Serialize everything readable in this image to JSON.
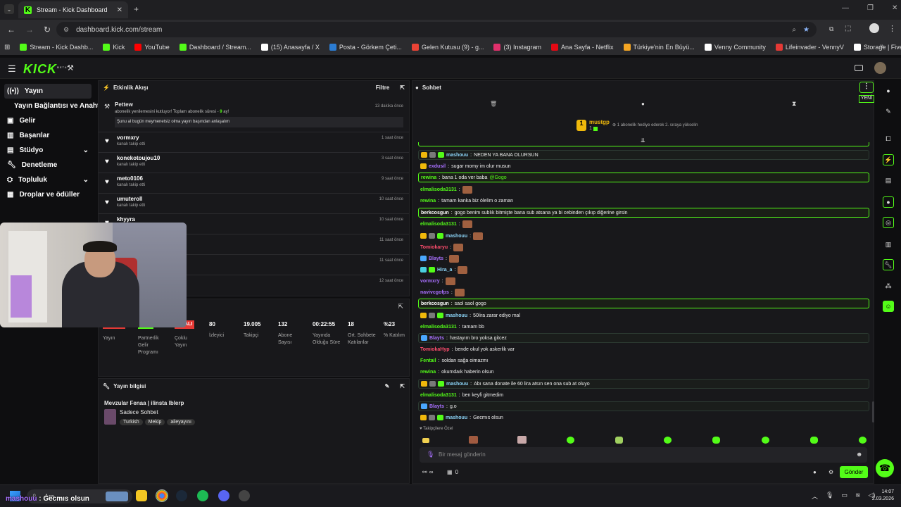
{
  "browser": {
    "tab_title": "Stream - Kick Dashboard",
    "url": "dashboard.kick.com/stream"
  },
  "bookmarks": [
    {
      "label": "Stream - Kick Dashb...",
      "color": "#53fc18"
    },
    {
      "label": "Kick",
      "color": "#53fc18"
    },
    {
      "label": "YouTube",
      "color": "#ff0000"
    },
    {
      "label": "Dashboard / Stream...",
      "color": "#53fc18"
    },
    {
      "label": "(15) Anasayfa / X",
      "color": "#ffffff"
    },
    {
      "label": "Posta - Görkem Çeti...",
      "color": "#2b7cd3"
    },
    {
      "label": "Gelen Kutusu (9) - g...",
      "color": "#ea4335"
    },
    {
      "label": "(3) Instagram",
      "color": "#e1306c"
    },
    {
      "label": "Ana Sayfa - Netflix",
      "color": "#e50914"
    },
    {
      "label": "Türkiye'nin En Büyü...",
      "color": "#f5a623"
    },
    {
      "label": "Venny Community",
      "color": "#ffffff"
    },
    {
      "label": "Lifeinvader - VennyV",
      "color": "#e53935"
    },
    {
      "label": "Storage | Fivemanage",
      "color": "#ffffff"
    }
  ],
  "kick": {
    "logo": "KICK",
    "beta": "BETA"
  },
  "sidebar": [
    {
      "label": "Yayın",
      "icon": "broadcast-icon"
    },
    {
      "label": "Yayın Bağlantısı ve Anahtarı",
      "icon": "key-icon"
    },
    {
      "label": "Gelir",
      "icon": "money-icon"
    },
    {
      "label": "Başarılar",
      "icon": "trophy-icon"
    },
    {
      "label": "Stüdyo",
      "icon": "studio-icon"
    },
    {
      "label": "Denetleme",
      "icon": "wrench-icon"
    },
    {
      "label": "Topluluk",
      "icon": "community-icon"
    },
    {
      "label": "Droplar ve ödüller",
      "icon": "gift-icon"
    }
  ],
  "activity": {
    "title": "Etkinlik Akışı",
    "filter": "Filtre",
    "first": {
      "name": "Pettew",
      "time": "13 dakika önce",
      "desc_pre": "abonelik yenilemesini kutluyor! Toplam abonelik süresi - ",
      "months": "9",
      "desc_post": " ay!",
      "quote": "Şunu al bugün meymenetsiz olma yayın başından anlaşalım"
    },
    "events": [
      {
        "name": "vormxry",
        "desc": "kanalı takip etti",
        "time": "1 saat önce"
      },
      {
        "name": "konekotoujou10",
        "desc": "kanalı takip etti",
        "time": "3 saat önce"
      },
      {
        "name": "meto0106",
        "desc": "kanalı takip etti",
        "time": "9 saat önce"
      },
      {
        "name": "umuteroll",
        "desc": "kanalı takip etti",
        "time": "10 saat önce"
      },
      {
        "name": "khyyra",
        "desc": "",
        "time": "10 saat önce"
      },
      {
        "name": "",
        "desc": "",
        "time": "11 saat önce"
      },
      {
        "name": "",
        "desc": "",
        "time": "11 saat önce"
      },
      {
        "name": "",
        "desc": "",
        "time": "12 saat önce"
      }
    ]
  },
  "stats": [
    {
      "value": "",
      "label": "Yayın"
    },
    {
      "value": "",
      "label": "Partnerlik Gelir Programı"
    },
    {
      "value": "ALI",
      "label": "Çoklu Yayın"
    },
    {
      "value": "80",
      "label": "İzleyici"
    },
    {
      "value": "19.005",
      "label": "Takipçi"
    },
    {
      "value": "132",
      "label": "Abone Sayısı"
    },
    {
      "value": "00:22:55",
      "label": "Yayında Olduğu Süre"
    },
    {
      "value": "18",
      "label": "Ort. Sohbete Katılanlar"
    },
    {
      "value": "%23",
      "label": "% Katılım"
    }
  ],
  "stream_info": {
    "title": "Yayın bilgisi",
    "stream_title": "Mevzular Fenaa | ilinsta lblerp",
    "category": "Sadece Sohbet",
    "tags": [
      "Turkish",
      "Mekip",
      "aileyayını"
    ]
  },
  "chat": {
    "title": "Sohbet",
    "new_label": "YENİ",
    "pinned": {
      "user": "mustgp",
      "rank": "1",
      "count": "1",
      "text": "1 abonelik hediye ederek 2. sıraya yükselin"
    },
    "messages": [
      {
        "user": "mashouu",
        "color": "#8bd3f6",
        "text": "NEDEN YA BANA OLURSUN",
        "badges": [
          "crown",
          "shield",
          "green"
        ],
        "style": "hl2"
      },
      {
        "user": "exdusil",
        "color": "#a970ff",
        "text": "sugar momy im olur musun",
        "badges": [
          "crown"
        ],
        "style": ""
      },
      {
        "user": "rewina",
        "color": "#53fc18",
        "text": "bana 1 oda ver baba",
        "mention": "@Gogo",
        "badges": [],
        "style": "hl"
      },
      {
        "user": "elmalisoda3131",
        "color": "#53fc18",
        "text": "",
        "emote": true,
        "badges": [],
        "style": ""
      },
      {
        "user": "rewina",
        "color": "#53fc18",
        "text": "tamam kanka biz ölelim o zaman",
        "badges": [],
        "style": ""
      },
      {
        "user": "berkcosgun",
        "color": "#ffffff",
        "text": "gogo benim sublık bitmişte bana sub atsana ya bi cebinden çıkıp diğerine girsin",
        "badges": [],
        "style": "hl"
      },
      {
        "user": "elmalisoda3131",
        "color": "#53fc18",
        "text": "",
        "emote": true,
        "badges": [],
        "style": ""
      },
      {
        "user": "mashouu",
        "color": "#8bd3f6",
        "text": "",
        "emote": true,
        "badges": [
          "crown",
          "shield",
          "green"
        ],
        "style": ""
      },
      {
        "user": "Tomiokaryu",
        "color": "#ff4d6d",
        "text": "",
        "emote": true,
        "badges": [],
        "style": ""
      },
      {
        "user": "Blayts",
        "color": "#a970ff",
        "text": "",
        "emote": true,
        "badges": [
          "blue"
        ],
        "style": ""
      },
      {
        "user": "Hira_a",
        "color": "#8bd3f6",
        "text": "",
        "emote": true,
        "badges": [
          "cyan",
          "green"
        ],
        "style": ""
      },
      {
        "user": "vormxry",
        "color": "#a970ff",
        "text": "",
        "emote": true,
        "badges": [],
        "style": ""
      },
      {
        "user": "navivcgofps",
        "color": "#a970ff",
        "text": "",
        "emote": true,
        "badges": [],
        "style": ""
      },
      {
        "user": "berkcosgun",
        "color": "#ffffff",
        "text": "saol saol gogo",
        "badges": [],
        "style": "hl"
      },
      {
        "user": "mashouu",
        "color": "#8bd3f6",
        "text": "50lira zarar ediyo mal",
        "badges": [
          "crown",
          "shield",
          "green"
        ],
        "style": ""
      },
      {
        "user": "elmalisoda3131",
        "color": "#53fc18",
        "text": "tamam bb",
        "badges": [],
        "style": ""
      },
      {
        "user": "Blayts",
        "color": "#a970ff",
        "text": "hastayım bro yoksa gitcez",
        "badges": [
          "blue"
        ],
        "style": "hl2"
      },
      {
        "user": "TomiokaHyp",
        "color": "#ff4d6d",
        "text": "bende okul yok askerlik var",
        "badges": [],
        "style": ""
      },
      {
        "user": "Fentail",
        "color": "#53fc18",
        "text": "soldan sağa oimazmı",
        "badges": [],
        "style": ""
      },
      {
        "user": "rewina",
        "color": "#53fc18",
        "text": "okumdaık haberin olsun",
        "badges": [],
        "style": ""
      },
      {
        "user": "mashouu",
        "color": "#8bd3f6",
        "text": "Abı sana donate ile 60 lira atsın sen ona sub at oluyo",
        "badges": [
          "crown",
          "shield",
          "green"
        ],
        "style": "hl2"
      },
      {
        "user": "elmalisoda3131",
        "color": "#53fc18",
        "text": "ben keyfi gitmedim",
        "badges": [],
        "style": ""
      },
      {
        "user": "Blayts",
        "color": "#a970ff",
        "text": "g.o",
        "badges": [
          "blue"
        ],
        "style": "hl2"
      },
      {
        "user": "mashouu",
        "color": "#8bd3f6",
        "text": "Gecmıs olsun",
        "badges": [
          "crown",
          "shield",
          "green"
        ],
        "style": ""
      }
    ],
    "followers_label": "Takipçilere Özel",
    "input_placeholder": "Bir mesaj gönderin",
    "points": "∞",
    "drops": "0",
    "send": "Gönder"
  },
  "taskbar": {
    "search": "Ara",
    "time": "14:07",
    "date": "2.03.2026",
    "overlay_user": "mashouu",
    "overlay_text": "Gecmıs olsun"
  }
}
